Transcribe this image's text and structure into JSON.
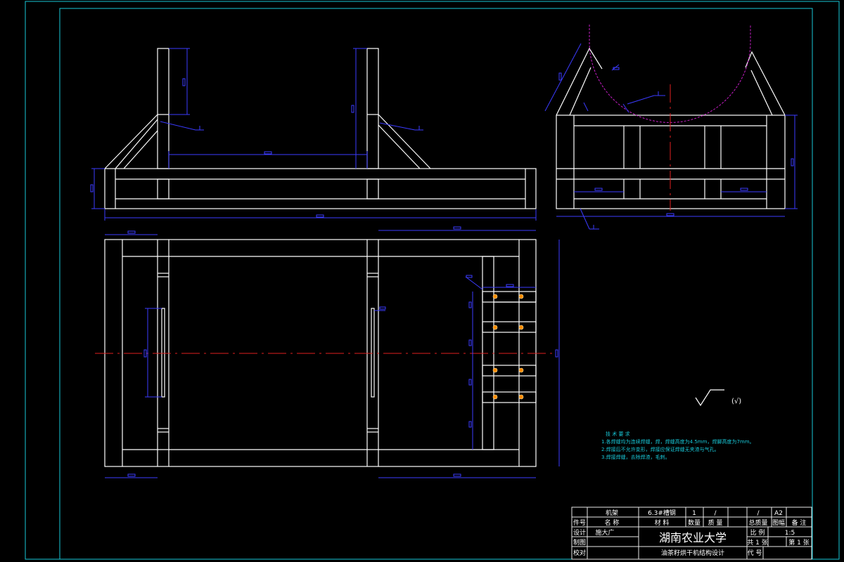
{
  "title_block": {
    "part_name": "机架",
    "material": "6.3#槽钢",
    "quantity": "1",
    "unit_weight": "/",
    "total_weight": "/",
    "sheet_size": "A2",
    "hdr_no": "件号",
    "hdr_name": "名    称",
    "hdr_material": "材    料",
    "hdr_qty": "数量",
    "hdr_weight": "质 量",
    "hdr_totalweight": "总质量",
    "hdr_drawing": "图幅",
    "hdr_remark": "备 注",
    "design": "设计",
    "designer": "施大广",
    "draw": "制图",
    "check": "校对",
    "university": "湖南农业大学",
    "drawing_title": "油茶籽烘干机结构设计",
    "scale_label": "比 例",
    "scale": "1:5",
    "sheets_total": "共 1 张",
    "sheet_no": "第 1 张",
    "code_label": "代 号"
  },
  "requirements": {
    "heading": "技 术 要 求",
    "items": [
      "1.各焊缝均为连续焊缝，焊，焊缝高度为4.5mm，焊脚高度为7mm。",
      "2.焊接后不允许变形，焊接应保证焊缝无夹渣与气孔。",
      "3.焊接焊缝，去除焊渣，毛刺。"
    ]
  },
  "roughness": {
    "symbol": "(√)"
  },
  "colors": {
    "background": "#000000",
    "geometry": "#ffffff",
    "dimension": "#3b3bff",
    "frame": "#18c8d8",
    "centerline": "#e02020",
    "drum_arc": "#c81ec8",
    "bolt": "#ff8c00"
  }
}
